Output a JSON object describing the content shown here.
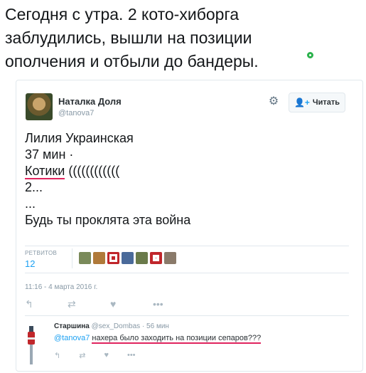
{
  "headline": {
    "line1": "Сегодня с утра. 2 кото-хиборга",
    "line2": "заблудились, вышли на позиции",
    "line3": "ополчения и отбыли до бандеры."
  },
  "tweet": {
    "author_name": "Наталка Доля",
    "author_handle": "@tanova7",
    "follow_label": "Читать",
    "gear_icon": "gear-icon",
    "lines": {
      "l1": "Лилия Украинская",
      "l2": "37 мин ·",
      "l3_underlined": "Котики",
      "l3_rest": " ((((((((((((",
      "l4": "2...",
      "l5": "...",
      "l6": "Будь ты проклята эта война"
    },
    "retweets_label": "РЕТВИТОВ",
    "retweets_count": "12",
    "timestamp": "11:16 - 4 марта 2016 г.",
    "actions": {
      "reply": "↰",
      "retweet": "⇄",
      "like": "♥",
      "more": "•••"
    }
  },
  "reply": {
    "author_name": "Старшина",
    "author_meta": "@sex_Dombas · 56 мин",
    "mention": "@tanova7",
    "text": "нахера было заходить на позиции сепаров???",
    "actions": {
      "reply": "↰",
      "retweet": "⇄",
      "like": "♥",
      "more": "•••"
    }
  },
  "colors": {
    "accent": "#1da1f2",
    "underline": "#e0245e",
    "green_dot": "#2bb24c",
    "muted": "#8899a6"
  }
}
